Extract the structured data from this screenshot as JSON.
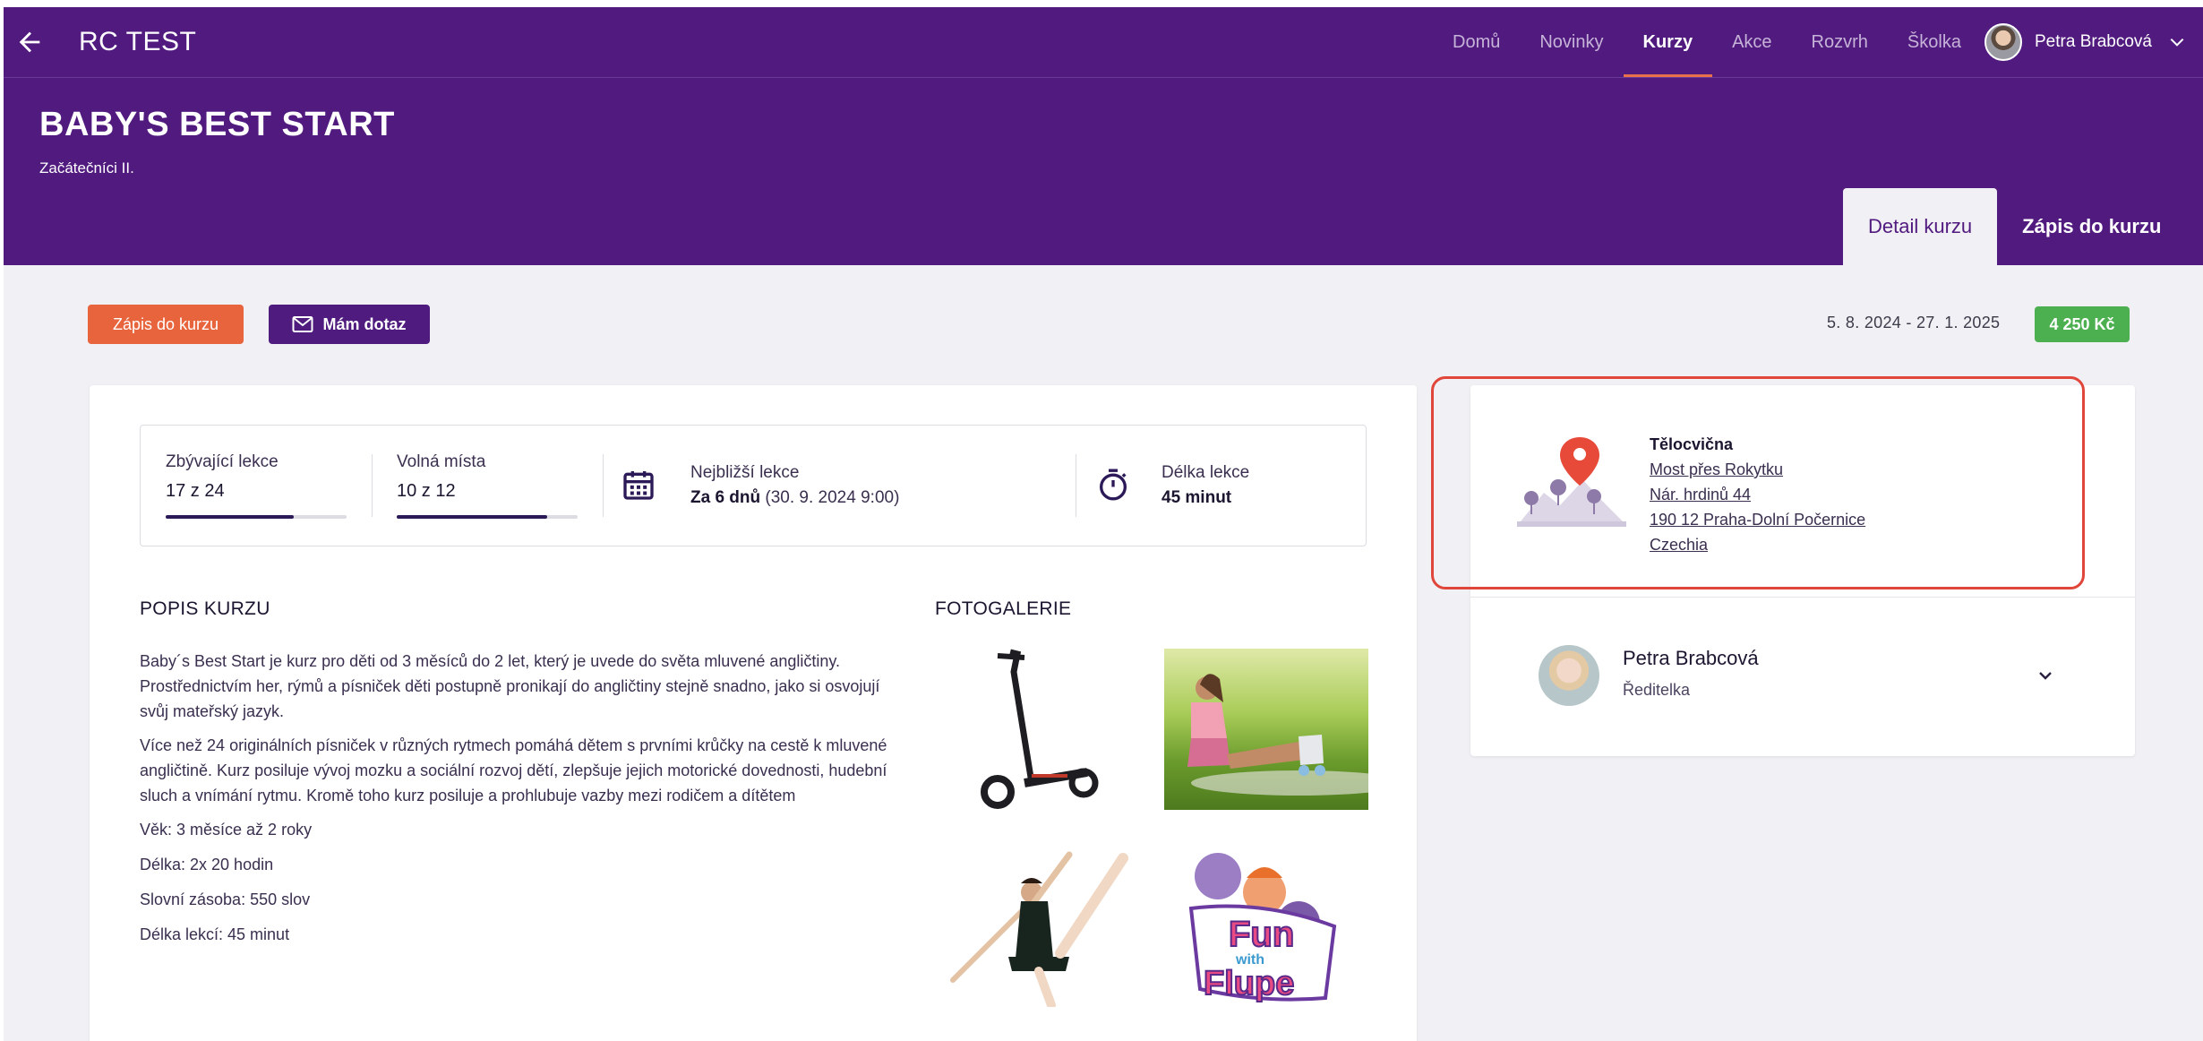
{
  "header": {
    "app_title": "RC TEST",
    "nav": [
      "Domů",
      "Novinky",
      "Kurzy",
      "Akce",
      "Rozvrh",
      "Školka"
    ],
    "active_nav": "Kurzy",
    "user_name": "Petra Brabcová"
  },
  "hero": {
    "title": "BABY'S BEST START",
    "subtitle": "Začátečníci II.",
    "tabs": [
      {
        "label": "Detail kurzu",
        "active": true
      },
      {
        "label": "Zápis do kurzu",
        "active": false
      }
    ]
  },
  "actions": {
    "enroll_label": "Zápis do kurzu",
    "ask_label": "Mám dotaz",
    "date_range": "5. 8. 2024 - 27. 1. 2025",
    "price": "4 250 Kč"
  },
  "stats": {
    "remaining_label": "Zbývající lekce",
    "remaining_value": "17 z 24",
    "remaining_fraction": 0.708,
    "free_label": "Volná místa",
    "free_value": "10 z 12",
    "free_fraction": 0.833,
    "next_label": "Nejbližší lekce",
    "next_value_bold": "Za 6 dnů",
    "next_value_rest": "(30. 9. 2024 9:00)",
    "length_label": "Délka lekce",
    "length_value": "45 minut"
  },
  "description": {
    "heading": "POPIS KURZU",
    "para1": "Baby´s Best Start je kurz pro děti od 3 měsíců do 2 let, který je uvede do světa mluvené angličtiny. Prostřednictvím her, rýmů a písniček děti postupně pronikají do angličtiny stejně snadno, jako si osvojují svůj mateřský jazyk.",
    "para2": "Více než 24 originálních písniček v různých rytmech pomáhá dětem s prvními krůčky na cestě k mluvené angličtině. Kurz posiluje vývoj mozku a sociální rozvoj dětí, zlepšuje jejich motorické dovednosti, hudební sluch a vnímání rytmu. Kromě toho kurz posiluje a prohlubuje vazby mezi rodičem a dítětem",
    "lines": [
      "Věk: 3 měsíce až 2 roky",
      "Délka: 2x 20 hodin",
      "Slovní zásoba: 550 slov",
      "Délka lekcí: 45 minut"
    ]
  },
  "gallery": {
    "heading": "FOTOGALERIE",
    "logo_text_1": "Fun",
    "logo_text_2": "with",
    "logo_text_3": "Flupe"
  },
  "location": {
    "name": "Tělocvična",
    "lines": [
      "Most přes Rokytku",
      "Nár. hrdinů 44",
      "190 12 Praha-Dolní Počernice",
      "Czechia"
    ]
  },
  "person": {
    "name": "Petra Brabcová",
    "role": "Ředitelka"
  },
  "colors": {
    "brand": "#511a7f",
    "accent": "#e8643c",
    "price": "#4caf50",
    "highlight": "#e0463a"
  }
}
